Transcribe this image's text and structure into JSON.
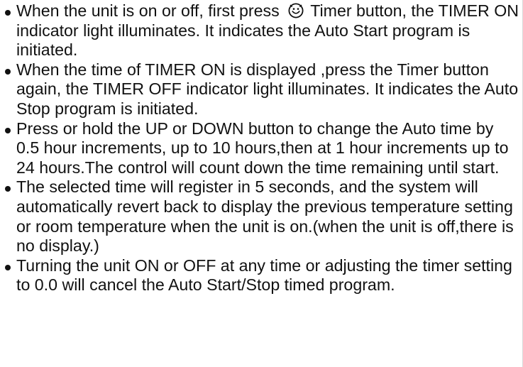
{
  "instructions": [
    {
      "before_icon": "When the unit is on or off, first press ",
      "icon": "timer-smiley-icon",
      "after_icon": " Timer button, the TIMER ON indicator light illuminates. It indicates the Auto Start program is initiated."
    },
    {
      "text": "When the time of TIMER ON is displayed ,press the Timer button again, the TIMER OFF indicator light illuminates. It indicates the Auto Stop program is initiated."
    },
    {
      "text": "Press or hold the UP or DOWN button to change the Auto time by 0.5 hour increments, up to 10 hours,then at 1 hour increments up to 24 hours.The control will count down the time remaining until start."
    },
    {
      "text": "The selected time will register in 5 seconds, and the system will automatically revert back to display the previous temperature setting or room temperature when the unit is on.(when the unit is off,there is no display.)"
    },
    {
      "text": "Turning the unit ON or OFF at any time or adjusting the timer setting to 0.0 will cancel the Auto Start/Stop timed program."
    }
  ]
}
